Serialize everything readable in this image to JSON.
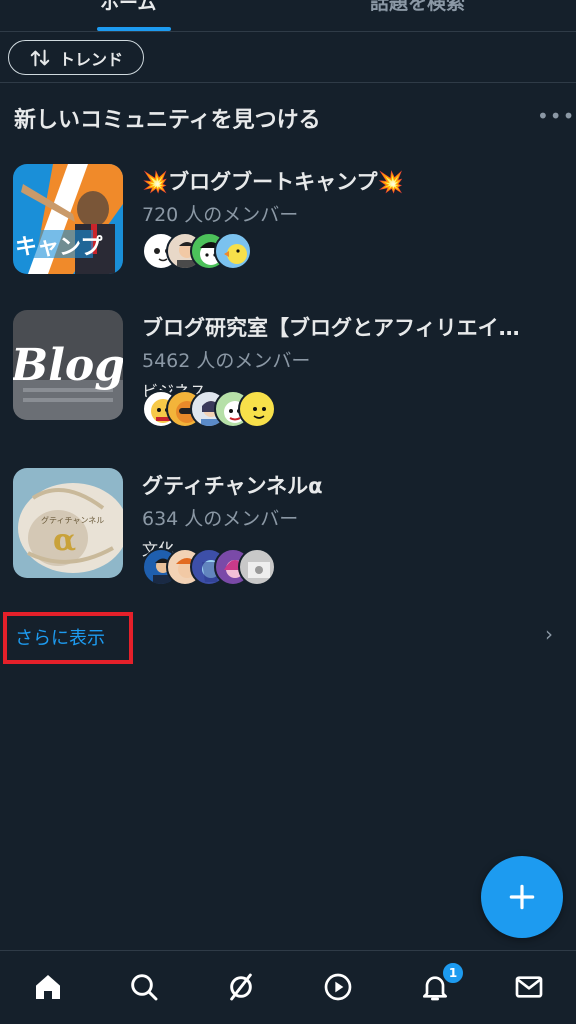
{
  "tabs": [
    {
      "label": "ホーム",
      "active": true
    },
    {
      "label": "話題を検索",
      "active": false
    }
  ],
  "trend_button": {
    "label": "トレンド"
  },
  "section": {
    "title": "新しいコミュニティを見つける",
    "more": "•••"
  },
  "communities": [
    {
      "name": "💥ブログブートキャンプ💥",
      "members": "720 人のメンバー",
      "category": ""
    },
    {
      "name": "ブログ研究室【ブログとアフィリエイ…",
      "members": "5462 人のメンバー",
      "category": "ビジネス"
    },
    {
      "name": "グティチャンネルα",
      "members": "634 人のメンバー",
      "category": "文化"
    }
  ],
  "thumb_text": {
    "blog": "Blog",
    "bootcamp": "キャンプ",
    "alpha": "α",
    "alpha_small": "グティチャンネル"
  },
  "show_more": {
    "label": "さらに表示"
  },
  "notifications": {
    "badge": "1"
  },
  "colors": {
    "background": "#15202b",
    "accent": "#1d9bf0",
    "highlight_border": "#e5202a",
    "muted": "#8b98a5"
  },
  "icons": [
    "home-icon",
    "search-icon",
    "spaces-icon",
    "play-icon",
    "bell-icon",
    "mail-icon",
    "plus-icon",
    "sort-arrows-icon",
    "chevron-right-icon"
  ]
}
